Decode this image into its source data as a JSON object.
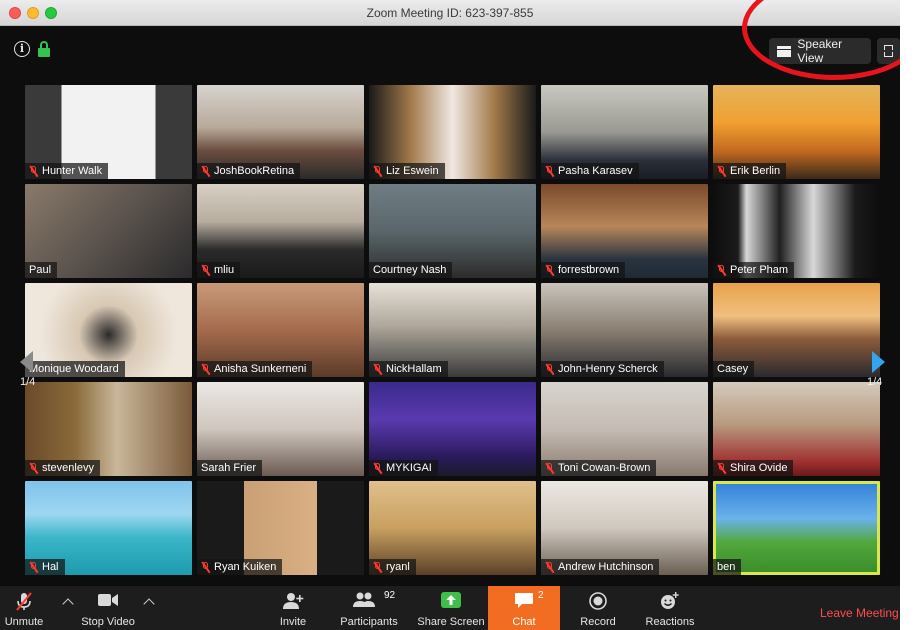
{
  "window": {
    "title": "Zoom Meeting ID: 623-397-855"
  },
  "top_bar": {
    "speaker_view_label": "Speaker View"
  },
  "grid": {
    "page_indicator_left": "1/4",
    "page_indicator_right": "1/4",
    "participants": [
      {
        "name": "Hunter Walk",
        "bg": "linear-gradient(90deg,#3a3a3a 0%,#3a3a3a 22%,#f2f2f2 22%,#f2f2f2 78%,#3a3a3a 78%)",
        "muted": true
      },
      {
        "name": "JoshBookRetina",
        "bg": "linear-gradient(180deg,#d7d3ce 0%,#b8aa9a 45%,#6b4d3f 70%,#2a2a2a 100%)",
        "muted": true
      },
      {
        "name": "Liz Eswein",
        "bg": "linear-gradient(90deg,#1a1a1a 0%,#a27a4a 25%,#f0e8e2 50%,#a27a4a 75%,#1a1a1a 100%)",
        "muted": true
      },
      {
        "name": "Pasha Karasev",
        "bg": "linear-gradient(180deg,#c8c8c0 0%,#9a9a92 50%,#2b2f3a 80%,#1a1d24 100%)",
        "muted": true
      },
      {
        "name": "Erik Berlin",
        "bg": "linear-gradient(180deg,#e4b45a 0%,#f0a030 40%,#c46a20 70%,#3a2a1a 100%)",
        "muted": true
      },
      {
        "name": "Paul",
        "bg": "linear-gradient(135deg,#8a7a6a 0%,#5b534d 50%,#2b2a2c 100%)",
        "muted": false
      },
      {
        "name": "mliu",
        "bg": "linear-gradient(180deg,#d8d0c4 0%,#b7ad9f 40%,#2a2a2a 70%,#1a1a1a 100%)",
        "muted": true
      },
      {
        "name": "Courtney Nash",
        "bg": "linear-gradient(180deg,#6f7e84 0%,#5a666a 50%,#2c2c2c 100%)",
        "muted": false
      },
      {
        "name": "forrestbrown",
        "bg": "linear-gradient(180deg,#7a4a2a 0%,#b8865a 45%,#2a3440 80%,#1e2a36 100%)",
        "muted": true
      },
      {
        "name": "Peter Pham",
        "bg": "linear-gradient(90deg,#0d0d0d 0%,#1b1b1b 15%,#d8d8d8 20%,#202020 40%,#d8d8d8 60%,#1b1b1b 85%,#0d0d0d 100%)",
        "muted": true
      },
      {
        "name": "Monique Woodard",
        "bg": "radial-gradient(circle at 50% 55%,#2a2a2a 0%,#d8c8b4 30%,#efe7dc 70%)",
        "muted": false
      },
      {
        "name": "Anisha Sunkerneni",
        "bg": "linear-gradient(180deg,#c89a7a 0%,#a56c4c 50%,#5a3a2a 100%)",
        "muted": true
      },
      {
        "name": "NickHallam",
        "bg": "linear-gradient(180deg,#e6e1d8 0%,#b0a89c 45%,#3a3a3a 100%)",
        "muted": true
      },
      {
        "name": "John-Henry Scherck",
        "bg": "linear-gradient(180deg,#c9c4bc 0%,#8a7f72 50%,#2a2a2e 100%)",
        "muted": true
      },
      {
        "name": "Casey",
        "bg": "linear-gradient(180deg,#e8a24a 0%,#f0c080 35%,#8a5a3a 60%,#2a2a2e 100%)",
        "muted": false
      },
      {
        "name": "stevenlevy",
        "bg": "linear-gradient(90deg,#6a4a2a 0%,#8a6a3a 30%,#c9b79a 55%,#7a5a3a 100%)",
        "muted": true
      },
      {
        "name": "Sarah Frier",
        "bg": "linear-gradient(180deg,#ece8e4 0%,#cfc6be 50%,#6a5a52 100%)",
        "muted": false
      },
      {
        "name": "MYKIGAI",
        "bg": "linear-gradient(180deg,#3b2a8a 0%,#5a3ab0 40%,#2a1a5a 80%,#1a1a2a 100%)",
        "muted": true
      },
      {
        "name": "Toni Cowan-Brown",
        "bg": "linear-gradient(180deg,#d8d4cf 0%,#c4bcb4 50%,#8a7a6e 100%)",
        "muted": true
      },
      {
        "name": "Shira Ovide",
        "bg": "linear-gradient(180deg,#d4cabc 0%,#b89a80 45%,#a03030 85%,#6a1a1a 100%)",
        "muted": true
      },
      {
        "name": "Hal",
        "bg": "linear-gradient(180deg,#7fc3ec 0%,#9fd6f0 35%,#3ab6c8 60%,#1e9aae 100%)",
        "muted": true
      },
      {
        "name": "Ryan Kuiken",
        "bg": "linear-gradient(90deg,#1a1a1a 0%,#1a1a1a 28%,#c9a074 28%,#d9b084 72%,#1a1a1a 72%)",
        "muted": true
      },
      {
        "name": "ryanl",
        "bg": "linear-gradient(180deg,#e0c08a 0%,#c8a060 50%,#5a4028 100%)",
        "muted": true
      },
      {
        "name": "Andrew Hutchinson",
        "bg": "linear-gradient(180deg,#ece8e2 0%,#cfc8be 50%,#6a5e52 100%)",
        "muted": true
      },
      {
        "name": "ben",
        "bg": "linear-gradient(180deg,#2f7fd6 0%,#6ab2ec 40%,#52a83c 65%,#3a8a2a 100%)",
        "muted": false,
        "active": true
      }
    ]
  },
  "toolbar": {
    "unmute": "Unmute",
    "stop_video": "Stop Video",
    "invite": "Invite",
    "participants": "Participants",
    "participants_count": "92",
    "share_screen": "Share Screen",
    "chat": "Chat",
    "chat_count": "2",
    "record": "Record",
    "reactions": "Reactions",
    "leave": "Leave Meeting"
  },
  "colors": {
    "accent_chat": "#f26d21",
    "leave_red": "#ff4d4d",
    "share_green": "#3fbf4a",
    "annotation_red": "#e8141c",
    "active_speaker": "#d8e84a"
  }
}
